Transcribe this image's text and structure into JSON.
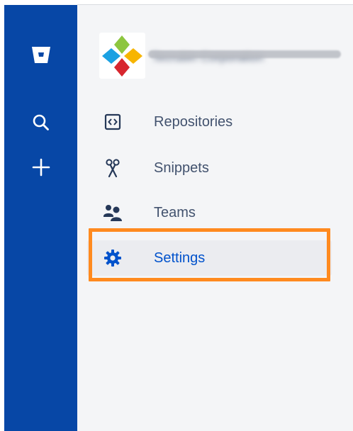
{
  "global_nav": {
    "logo_icon": "bitbucket-logo-icon",
    "search_icon": "search-icon",
    "create_icon": "plus-icon",
    "background": "#0747a6"
  },
  "team": {
    "name": "Tecrubin Corporation",
    "logo_icon": "team-logo-icon"
  },
  "menu": {
    "items": [
      {
        "label": "Repositories",
        "icon": "repository-icon"
      },
      {
        "label": "Snippets",
        "icon": "scissors-icon"
      },
      {
        "label": "Teams",
        "icon": "people-icon"
      },
      {
        "label": "Settings",
        "icon": "gear-icon",
        "selected": true
      }
    ]
  },
  "colors": {
    "accent": "#0052cc",
    "text": "#42526e",
    "highlight": "#ff8a1f",
    "panel": "#f4f5f7"
  }
}
